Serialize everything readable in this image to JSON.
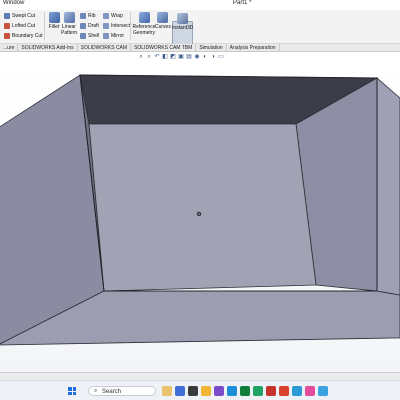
{
  "titlebar": {
    "menu": "Window",
    "document": "Part1 *"
  },
  "ribbon": {
    "sweep_cut": "Swept Cut",
    "lofted_cut": "Lofted Cut",
    "boundary_cut": "Boundary Cut",
    "fillet": "Fillet",
    "linear_pattern": "Linear Pattern",
    "rib": "Rib",
    "draft": "Draft",
    "shell": "Shell",
    "wrap": "Wrap",
    "intersect": "Intersect",
    "mirror": "Mirror",
    "reference_geometry": "Reference Geometry",
    "curves": "Curves",
    "instant3d": "Instant3D"
  },
  "tabs": [
    "...ure",
    "SOLIDWORKS Add-Ins",
    "SOLIDWORKS CAM",
    "SOLIDWORKS CAM TBM",
    "Simulation",
    "Analysis Preparation"
  ],
  "taskbar": {
    "search_label": "Search"
  },
  "colors": {
    "face_light": "#a1a2b4",
    "face_mid": "#8b8ca2",
    "face_dark": "#3c3d48",
    "edge": "#2b2c34",
    "accent": "#1e6fd9"
  }
}
